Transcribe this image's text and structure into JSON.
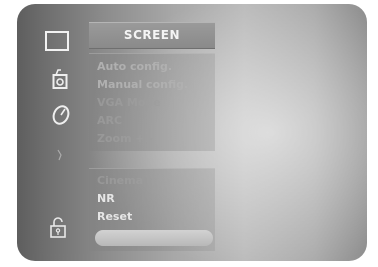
{
  "menu": {
    "title": "SCREEN",
    "items_group1": [
      {
        "label": "Auto config."
      },
      {
        "label": "Manual config."
      },
      {
        "label": "VGA Mode"
      },
      {
        "label": "ARC"
      },
      {
        "label": "Zoom +/-"
      }
    ],
    "items_group2": [
      {
        "label": "Cinema"
      },
      {
        "label": "NR"
      },
      {
        "label": "Reset"
      }
    ]
  },
  "side_icons": [
    {
      "name": "screen-icon"
    },
    {
      "name": "sound-icon"
    },
    {
      "name": "time-icon"
    },
    {
      "name": "special-icon"
    },
    {
      "name": "lock-icon"
    }
  ]
}
